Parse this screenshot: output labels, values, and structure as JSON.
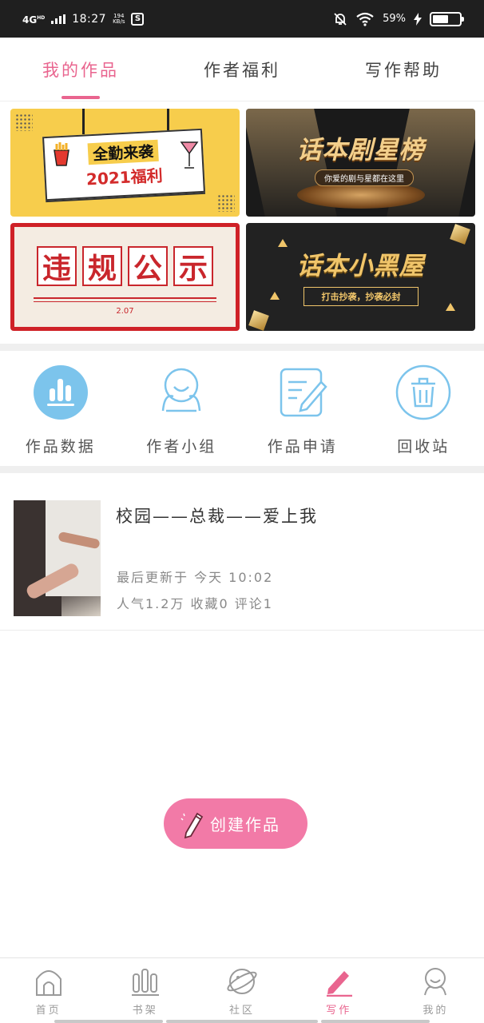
{
  "status_bar": {
    "network": "4G",
    "network_sup": "HD",
    "time": "18:27",
    "speed_value": "194",
    "speed_unit": "KB/s",
    "battery_pct": "59%",
    "battery_level": 0.59,
    "icons": [
      "signal-icon",
      "screenshot-app-icon",
      "mute-bell-icon",
      "wifi-icon",
      "charging-icon",
      "battery-icon"
    ]
  },
  "tabs": [
    {
      "label": "我的作品",
      "active": true
    },
    {
      "label": "作者福利",
      "active": false
    },
    {
      "label": "写作帮助",
      "active": false
    }
  ],
  "banners": {
    "welfare": {
      "line1": "全勤来袭",
      "line2": "2021福利"
    },
    "star": {
      "title": "话本剧星榜",
      "subtitle": "你爱的剧与星都在这里"
    },
    "violation": {
      "chars": [
        "违",
        "规",
        "公",
        "示"
      ],
      "date": "2.07"
    },
    "blackroom": {
      "title": "话本小黑屋",
      "subtitle": "打击抄袭，抄袭必封"
    }
  },
  "quick_actions": [
    {
      "label": "作品数据",
      "icon": "bar-chart-icon"
    },
    {
      "label": "作者小组",
      "icon": "author-group-icon"
    },
    {
      "label": "作品申请",
      "icon": "edit-document-icon"
    },
    {
      "label": "回收站",
      "icon": "trash-icon"
    }
  ],
  "work": {
    "title": "校园——总裁——爱上我",
    "updated": "最后更新于 今天 10:02",
    "stats": "人气1.2万 收藏0 评论1"
  },
  "create_button": {
    "label": "创建作品",
    "icon": "pencil-icon"
  },
  "bottom_nav": [
    {
      "label": "首页",
      "icon": "home-icon",
      "active": false
    },
    {
      "label": "书架",
      "icon": "bookshelf-icon",
      "active": false
    },
    {
      "label": "社区",
      "icon": "community-planet-icon",
      "active": false
    },
    {
      "label": "写作",
      "icon": "write-pen-icon",
      "active": true
    },
    {
      "label": "我的",
      "icon": "profile-icon",
      "active": false
    }
  ],
  "colors": {
    "accent": "#e9658f",
    "create_button": "#f27aa7",
    "icon_blue": "#7cc4ec"
  }
}
